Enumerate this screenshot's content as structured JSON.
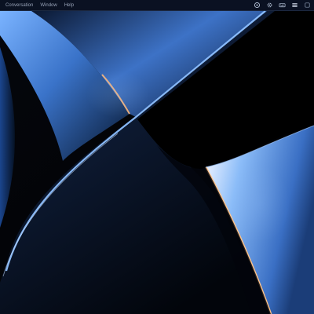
{
  "menubar": {
    "items": [
      {
        "label": "Conversation"
      },
      {
        "label": "Window"
      },
      {
        "label": "Help"
      }
    ],
    "status_icons": [
      {
        "name": "chat-status-icon"
      },
      {
        "name": "settings-icon"
      },
      {
        "name": "keyboard-icon"
      },
      {
        "name": "hamburger-menu-icon"
      },
      {
        "name": "control-center-icon"
      }
    ]
  },
  "colors": {
    "menubar_bg": "#0c1426",
    "wallpaper_blue": "#6da6f0",
    "wallpaper_dark": "#020308",
    "accent_orange": "#ffbf7a"
  }
}
